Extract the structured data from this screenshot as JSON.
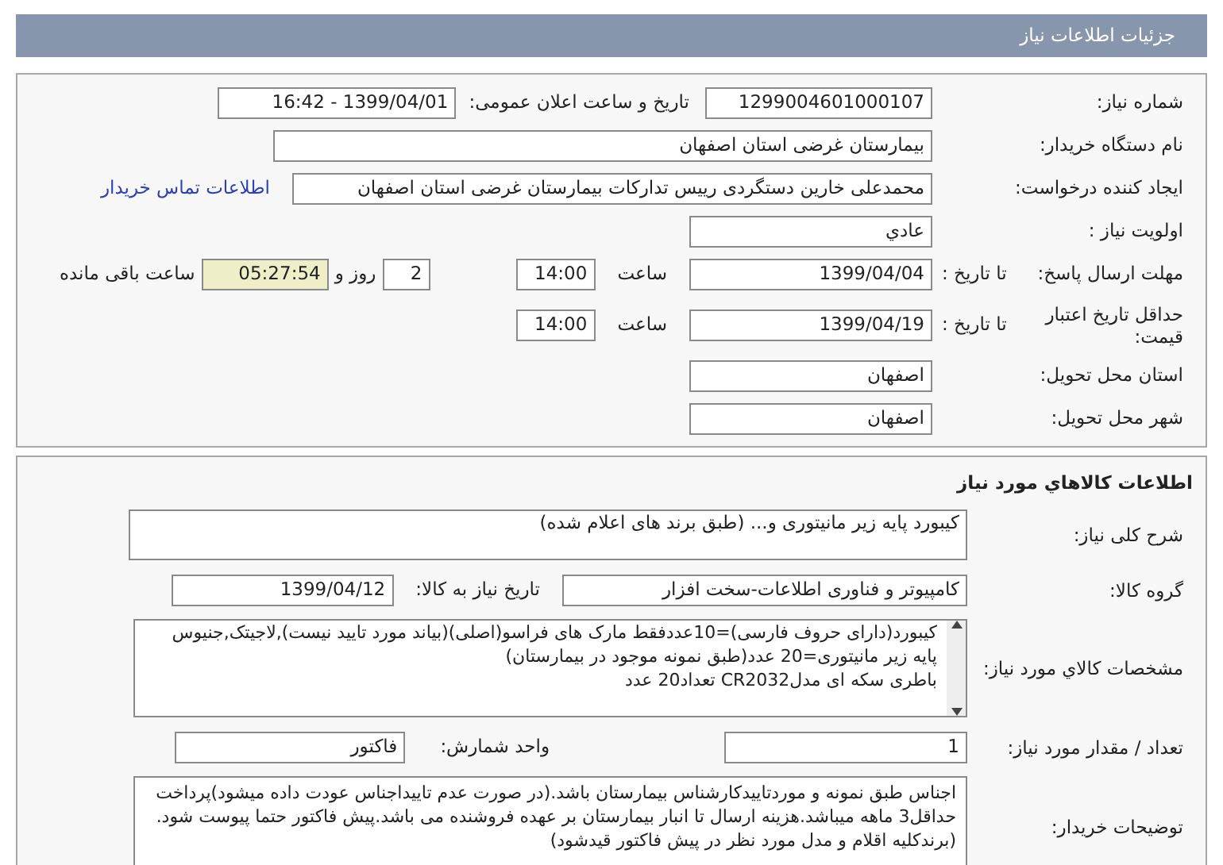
{
  "header": {
    "title": "جزئیات اطلاعات نیاز"
  },
  "need_info": {
    "need_number": {
      "label": "شماره نیاز:",
      "value": "1299004601000107"
    },
    "announce": {
      "label": "تاریخ و ساعت اعلان عمومی:",
      "value": "1399/04/01 - 16:42"
    },
    "buyer_org": {
      "label": "نام دستگاه خریدار:",
      "value": "بیمارستان غرضی استان اصفهان"
    },
    "requester": {
      "label": "ایجاد کننده درخواست:",
      "value": "محمدعلی خارین دستگردی رییس تدارکات بیمارستان غرضی استان اصفهان",
      "link": "اطلاعات تماس خریدار"
    },
    "priority": {
      "label": "اولویت نیاز :",
      "value": "عادي"
    },
    "deadline": {
      "label": "مهلت ارسال پاسخ:",
      "to_date_label": "تا تاریخ :",
      "date": "1399/04/04",
      "time_label": "ساعت",
      "time": "14:00",
      "days": "2",
      "days_label": "روز و",
      "remaining": "05:27:54",
      "remaining_label": "ساعت باقی مانده"
    },
    "validity": {
      "label": "حداقل تاریخ اعتبار قیمت:",
      "to_date_label": "تا تاریخ :",
      "date": "1399/04/19",
      "time_label": "ساعت",
      "time": "14:00"
    },
    "province": {
      "label": "استان محل تحویل:",
      "value": "اصفهان"
    },
    "city": {
      "label": "شهر محل تحویل:",
      "value": "اصفهان"
    }
  },
  "goods": {
    "title": "اطلاعات کالاهاي مورد نیاز",
    "summary": {
      "label": "شرح کلی نیاز:",
      "value": "کیبورد پایه زیر مانیتوری و... (طبق برند های اعلام شده)"
    },
    "group": {
      "label": "گروه کالا:",
      "value": "کامپیوتر و فناوری اطلاعات-سخت افزار",
      "date_label": "تاریخ نیاز به کالا:",
      "date": "1399/04/12"
    },
    "specs": {
      "label": "مشخصات کالاي مورد نیاز:",
      "lines": [
        "کیبورد(دارای حروف فارسی)=10عددفقط مارک های فراسو(اصلی)(بیاند مورد تایید نیست),لاجیتک,جنیوس",
        "پایه زیر مانیتوری=20 عدد(طبق نمونه موجود در بیمارستان)",
        "باطری سکه ای مدلCR2032 تعداد20 عدد"
      ]
    },
    "quantity": {
      "label": "تعداد / مقدار مورد نیاز:",
      "value": "1",
      "unit_label": "واحد شمارش:",
      "unit": "فاکتور"
    },
    "notes": {
      "label": "توضیحات خریدار:",
      "value": "اجناس طبق نمونه و موردتاییدکارشناس بیمارستان باشد.(در صورت عدم تاییداجناس عودت داده میشود)پرداخت حداقل3 ماهه میباشد.هزینه ارسال تا انبار بیمارستان بر عهده فروشنده می باشد.پیش فاکتور حتما پیوست شود.(برندکلیه اقلام و مدل مورد نظر در پیش فاکتور قیدشود)"
    }
  }
}
